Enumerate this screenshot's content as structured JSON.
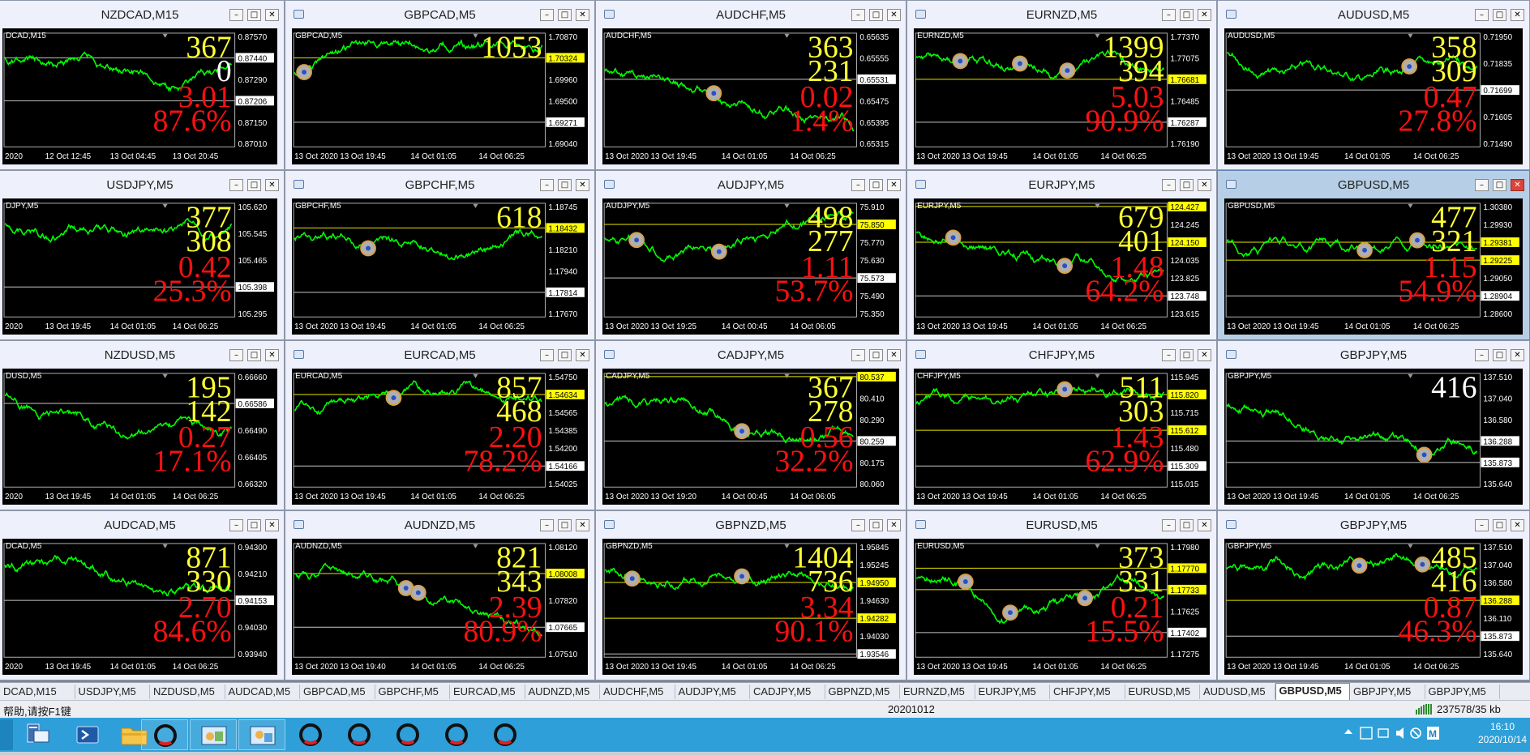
{
  "charts": [
    {
      "id": "nzdcad",
      "title": "NZDCAD,M15",
      "label": "DCAD,M15",
      "cut": true,
      "prices": [
        "0.87570",
        "0.87440",
        "0.87290",
        "0.87206",
        "0.87150",
        "0.87010"
      ],
      "hl": [
        {
          "p": "0.87440",
          "w": 1
        },
        {
          "p": "0.87206",
          "w": 1
        }
      ],
      "big1": "367",
      "big2": "0",
      "big2color": "#ffffff",
      "red1": "3.01",
      "red2": "87.6%",
      "times": [
        "2020",
        "12 Oct 12:45",
        "13 Oct 04:45",
        "13 Oct 20:45"
      ],
      "markers": []
    },
    {
      "id": "gbpcad",
      "title": "GBPCAD,M5",
      "label": "GBPCAD,M5",
      "cut": false,
      "prices": [
        "1.70870",
        "1.70324",
        "1.69960",
        "1.69500",
        "1.69271",
        "1.69040"
      ],
      "hl": [
        {
          "p": "1.70324",
          "y": 1
        },
        {
          "p": "1.69271",
          "w": 1
        }
      ],
      "big1": "1053",
      "big2": "",
      "big2color": "#ffff33",
      "red1": "",
      "red2": "",
      "times": [
        "13 Oct 2020",
        "13 Oct 19:45",
        "14 Oct 01:05",
        "14 Oct 06:25"
      ],
      "markers": [
        0.04
      ]
    },
    {
      "id": "audchf",
      "title": "AUDCHF,M5",
      "label": "AUDCHF,M5",
      "cut": false,
      "prices": [
        "0.65635",
        "0.65555",
        "0.65531",
        "0.65475",
        "0.65395",
        "0.65315"
      ],
      "hl": [
        {
          "p": "0.65531",
          "w": 1
        }
      ],
      "big1": "363",
      "big2": "231",
      "big2color": "#ffff33",
      "red1": "0.02",
      "red2": "1.4%",
      "times": [
        "13 Oct 2020",
        "13 Oct 19:45",
        "14 Oct 01:05",
        "14 Oct 06:25"
      ],
      "markers": [
        0.44
      ]
    },
    {
      "id": "eurnzd",
      "title": "EURNZD,M5",
      "label": "EURNZD,M5",
      "cut": false,
      "prices": [
        "1.77370",
        "1.77075",
        "1.76681",
        "1.76485",
        "1.76287",
        "1.76190"
      ],
      "hl": [
        {
          "p": "1.76681",
          "y": 1
        },
        {
          "p": "1.76287",
          "w": 1
        }
      ],
      "big1": "1399",
      "big2": "394",
      "big2color": "#ffff33",
      "red1": "5.03",
      "red2": "90.9%",
      "times": [
        "13 Oct 2020",
        "13 Oct 19:45",
        "14 Oct 01:05",
        "14 Oct 06:25"
      ],
      "markers": [
        0.18,
        0.42,
        0.61
      ]
    },
    {
      "id": "audusd",
      "title": "AUDUSD,M5",
      "label": "AUDUSD,M5",
      "cut": false,
      "prices": [
        "0.71950",
        "0.71835",
        "0.71699",
        "0.71605",
        "0.71490"
      ],
      "hl": [
        {
          "p": "0.71699",
          "w": 1
        }
      ],
      "big1": "358",
      "big2": "309",
      "big2color": "#ffff33",
      "red1": "0.47",
      "red2": "27.8%",
      "times": [
        "13 Oct 2020",
        "13 Oct 19:45",
        "14 Oct 01:05",
        "14 Oct 06:25"
      ],
      "markers": [
        0.73
      ]
    },
    {
      "id": "usdjpy",
      "title": "USDJPY,M5",
      "label": "DJPY,M5",
      "cut": true,
      "prices": [
        "105.620",
        "105.545",
        "105.465",
        "105.398",
        "105.295"
      ],
      "hl": [
        {
          "p": "105.398",
          "w": 1
        }
      ],
      "big1": "377",
      "big2": "308",
      "big2color": "#ffff33",
      "red1": "0.42",
      "red2": "25.3%",
      "times": [
        "2020",
        "13 Oct 19:45",
        "14 Oct 01:05",
        "14 Oct 06:25"
      ],
      "markers": []
    },
    {
      "id": "gbpchf",
      "title": "GBPCHF,M5",
      "label": "GBPCHF,M5",
      "cut": false,
      "prices": [
        "1.18745",
        "1.18432",
        "1.18210",
        "1.17940",
        "1.17814",
        "1.17670"
      ],
      "hl": [
        {
          "p": "1.18432",
          "y": 1
        },
        {
          "p": "1.17814",
          "w": 1
        }
      ],
      "big1": "618",
      "big2": "",
      "big2color": "#ffff33",
      "red1": "",
      "red2": "",
      "times": [
        "13 Oct 2020",
        "13 Oct 19:45",
        "14 Oct 01:05",
        "14 Oct 06:25"
      ],
      "markers": [
        0.3
      ]
    },
    {
      "id": "audjpy",
      "title": "AUDJPY,M5",
      "label": "AUDJPY,M5",
      "cut": false,
      "prices": [
        "75.910",
        "75.850",
        "75.770",
        "75.630",
        "75.573",
        "75.490",
        "75.350"
      ],
      "hl": [
        {
          "p": "75.850",
          "y": 1
        },
        {
          "p": "75.573",
          "w": 1
        }
      ],
      "big1": "498",
      "big2": "277",
      "big2color": "#ffff33",
      "red1": "1.11",
      "red2": "53.7%",
      "times": [
        "13 Oct 2020",
        "13 Oct 19:25",
        "14 Oct 00:45",
        "14 Oct 06:05"
      ],
      "markers": [
        0.13,
        0.46
      ]
    },
    {
      "id": "eurjpy",
      "title": "EURJPY,M5",
      "label": "EURJPY,M5",
      "cut": false,
      "prices": [
        "124.427",
        "124.245",
        "124.150",
        "124.035",
        "123.825",
        "123.748",
        "123.615"
      ],
      "hl": [
        {
          "p": "124.427",
          "y": 1
        },
        {
          "p": "124.150",
          "y": 1
        },
        {
          "p": "123.748",
          "w": 1
        }
      ],
      "big1": "679",
      "big2": "401",
      "big2color": "#ffff33",
      "red1": "1.48",
      "red2": "64.2%",
      "times": [
        "13 Oct 2020",
        "13 Oct 19:45",
        "14 Oct 01:05",
        "14 Oct 06:25"
      ],
      "markers": [
        0.15,
        0.6
      ]
    },
    {
      "id": "gbpusd",
      "title": "GBPUSD,M5",
      "label": "GBPUSD,M5",
      "cut": false,
      "active": true,
      "prices": [
        "1.30380",
        "1.29930",
        "1.29381",
        "1.29225",
        "1.29050",
        "1.28904",
        "1.28600"
      ],
      "hl": [
        {
          "p": "1.29381",
          "y": 1
        },
        {
          "p": "1.29225",
          "y": 1
        },
        {
          "p": "1.28904",
          "w": 1
        }
      ],
      "big1": "477",
      "big2": "321",
      "big2color": "#ffff33",
      "red1": "1.15",
      "red2": "54.9%",
      "times": [
        "13 Oct 2020",
        "13 Oct 19:45",
        "14 Oct 01:05",
        "14 Oct 06:25"
      ],
      "markers": [
        0.55,
        0.76
      ]
    },
    {
      "id": "nzdusd",
      "title": "NZDUSD,M5",
      "label": "DUSD,M5",
      "cut": true,
      "prices": [
        "0.66660",
        "0.66586",
        "0.66490",
        "0.66405",
        "0.66320"
      ],
      "hl": [
        {
          "p": "0.66586",
          "w": 1
        }
      ],
      "big1": "195",
      "big2": "142",
      "big2color": "#ffff33",
      "red1": "0.27",
      "red2": "17.1%",
      "times": [
        "2020",
        "13 Oct 19:45",
        "14 Oct 01:05",
        "14 Oct 06:25"
      ],
      "markers": []
    },
    {
      "id": "eurcad",
      "title": "EURCAD,M5",
      "label": "EURCAD,M5",
      "cut": false,
      "prices": [
        "1.54750",
        "1.54634",
        "1.54565",
        "1.54385",
        "1.54200",
        "1.54166",
        "1.54025"
      ],
      "hl": [
        {
          "p": "1.54634",
          "y": 1
        },
        {
          "p": "1.54166",
          "w": 1
        }
      ],
      "big1": "857",
      "big2": "468",
      "big2color": "#ffff33",
      "red1": "2.20",
      "red2": "78.2%",
      "times": [
        "13 Oct 2020",
        "13 Oct 19:45",
        "14 Oct 01:05",
        "14 Oct 06:25"
      ],
      "markers": [
        0.4
      ]
    },
    {
      "id": "cadjpy",
      "title": "CADJPY,M5",
      "label": "CADJPY,M5",
      "cut": false,
      "prices": [
        "80.537",
        "80.410",
        "80.290",
        "80.259",
        "80.175",
        "80.060"
      ],
      "hl": [
        {
          "p": "80.537",
          "y": 1
        },
        {
          "p": "80.259",
          "w": 1
        }
      ],
      "big1": "367",
      "big2": "278",
      "big2color": "#ffff33",
      "red1": "0.56",
      "red2": "32.2%",
      "times": [
        "13 Oct 2020",
        "13 Oct 19:20",
        "14 Oct 00:45",
        "14 Oct 06:05"
      ],
      "markers": [
        0.55
      ]
    },
    {
      "id": "chfjpy",
      "title": "CHFJPY,M5",
      "label": "CHFJPY,M5",
      "cut": false,
      "prices": [
        "115.945",
        "115.820",
        "115.715",
        "115.612",
        "115.480",
        "115.309",
        "115.015"
      ],
      "hl": [
        {
          "p": "115.820",
          "y": 1
        },
        {
          "p": "115.612",
          "y": 1
        },
        {
          "p": "115.309",
          "w": 1
        }
      ],
      "big1": "511",
      "big2": "303",
      "big2color": "#ffff33",
      "red1": "1.43",
      "red2": "62.9%",
      "times": [
        "13 Oct 2020",
        "13 Oct 19:45",
        "14 Oct 01:05",
        "14 Oct 06:25"
      ],
      "markers": [
        0.6
      ]
    },
    {
      "id": "gbpjpy",
      "title": "GBPJPY,M5",
      "label": "GBPJPY,M5",
      "cut": false,
      "prices": [
        "137.510",
        "137.040",
        "136.580",
        "136.288",
        "135.873",
        "135.640"
      ],
      "hl": [
        {
          "p": "136.288",
          "w": 1
        },
        {
          "p": "135.873",
          "w": 1
        }
      ],
      "big1": "416",
      "big2": "",
      "big2color": "#ffffff",
      "red1": "",
      "red2": "",
      "big1color": "#ffffff",
      "times": [
        "13 Oct 2020",
        "13 Oct 19:45",
        "14 Oct 01:05",
        "14 Oct 06:25"
      ],
      "markers": [
        0.79
      ]
    },
    {
      "id": "audcad",
      "title": "AUDCAD,M5",
      "label": "DCAD,M5",
      "cut": true,
      "prices": [
        "0.94300",
        "0.94210",
        "0.94153",
        "0.94030",
        "0.93940"
      ],
      "hl": [
        {
          "p": "0.94153",
          "w": 1
        }
      ],
      "big1": "871",
      "big2": "330",
      "big2color": "#ffff33",
      "red1": "2.70",
      "red2": "84.6%",
      "times": [
        "2020",
        "13 Oct 19:45",
        "14 Oct 01:05",
        "14 Oct 06:25"
      ],
      "markers": []
    },
    {
      "id": "audnzd",
      "title": "AUDNZD,M5",
      "label": "AUDNZD,M5",
      "cut": false,
      "prices": [
        "1.08120",
        "1.08008",
        "1.07820",
        "1.07665",
        "1.07510"
      ],
      "hl": [
        {
          "p": "1.08008",
          "y": 1
        },
        {
          "p": "1.07665",
          "w": 1
        }
      ],
      "big1": "821",
      "big2": "343",
      "big2color": "#ffff33",
      "red1": "2.39",
      "red2": "80.9%",
      "times": [
        "13 Oct 2020",
        "13 Oct 19:40",
        "14 Oct 01:05",
        "14 Oct 06:25"
      ],
      "markers": [
        0.45,
        0.5
      ]
    },
    {
      "id": "gbpnzd",
      "title": "GBPNZD,M5",
      "label": "GBPNZD,M5",
      "cut": false,
      "prices": [
        "1.95845",
        "1.95245",
        "1.94950",
        "1.94630",
        "1.94282",
        "1.94030",
        "1.93546"
      ],
      "hl": [
        {
          "p": "1.94950",
          "y": 1
        },
        {
          "p": "1.94282",
          "y": 1
        },
        {
          "p": "1.93546",
          "w": 1
        }
      ],
      "big1": "1404",
      "big2": "736",
      "big2color": "#ffff33",
      "red1": "3.34",
      "red2": "90.1%",
      "times": [
        "13 Oct 2020",
        "13 Oct 19:45",
        "14 Oct 01:05",
        "14 Oct 06:25"
      ],
      "markers": [
        0.11,
        0.55
      ]
    },
    {
      "id": "eurusd",
      "title": "EURUSD,M5",
      "label": "EURUSD,M5",
      "cut": false,
      "prices": [
        "1.17980",
        "1.17770",
        "1.17733",
        "1.17625",
        "1.17402",
        "1.17275"
      ],
      "hl": [
        {
          "p": "1.17770",
          "y": 1
        },
        {
          "p": "1.17733",
          "y": 1
        },
        {
          "p": "1.17402",
          "w": 1
        }
      ],
      "big1": "373",
      "big2": "331",
      "big2color": "#ffff33",
      "red1": "0.21",
      "red2": "15.5%",
      "times": [
        "13 Oct 2020",
        "13 Oct 19:45",
        "14 Oct 01:05",
        "14 Oct 06:25"
      ],
      "markers": [
        0.2,
        0.38,
        0.68
      ]
    },
    {
      "id": "gbpjpy2",
      "title": "GBPJPY,M5",
      "label": "GBPJPY,M5",
      "cut": false,
      "prices": [
        "137.510",
        "137.040",
        "136.580",
        "136.288",
        "136.110",
        "135.873",
        "135.640"
      ],
      "hl": [
        {
          "p": "136.288",
          "y": 1
        },
        {
          "p": "135.873",
          "w": 1
        }
      ],
      "big1": "485",
      "big2": "416",
      "big2color": "#ffff33",
      "red1": "0.87",
      "red2": "46.3%",
      "times": [
        "13 Oct 2020",
        "13 Oct 19:45",
        "14 Oct 01:05",
        "14 Oct 06:25"
      ],
      "markers": [
        0.53,
        0.78
      ]
    }
  ],
  "window_buttons": {
    "minimize": "–",
    "maximize": "□",
    "close": "✕"
  },
  "tabs": [
    "DCAD,M15",
    "USDJPY,M5",
    "NZDUSD,M5",
    "AUDCAD,M5",
    "GBPCAD,M5",
    "GBPCHF,M5",
    "EURCAD,M5",
    "AUDNZD,M5",
    "AUDCHF,M5",
    "AUDJPY,M5",
    "CADJPY,M5",
    "GBPNZD,M5",
    "EURNZD,M5",
    "EURJPY,M5",
    "CHFJPY,M5",
    "EURUSD,M5",
    "AUDUSD,M5",
    "GBPUSD,M5",
    "GBPJPY,M5",
    "GBPJPY,M5"
  ],
  "active_tab": 17,
  "status": {
    "help": "帮助,请按F1键",
    "profile": "20201012",
    "traffic": "237578/35 kb"
  },
  "clock": {
    "time": "16:10",
    "date": "2020/10/14"
  },
  "colors": {
    "candle": "#00ff00",
    "yellow_text": "#ffff33",
    "red_text": "#ff1010",
    "line": "#c0c0c0"
  }
}
